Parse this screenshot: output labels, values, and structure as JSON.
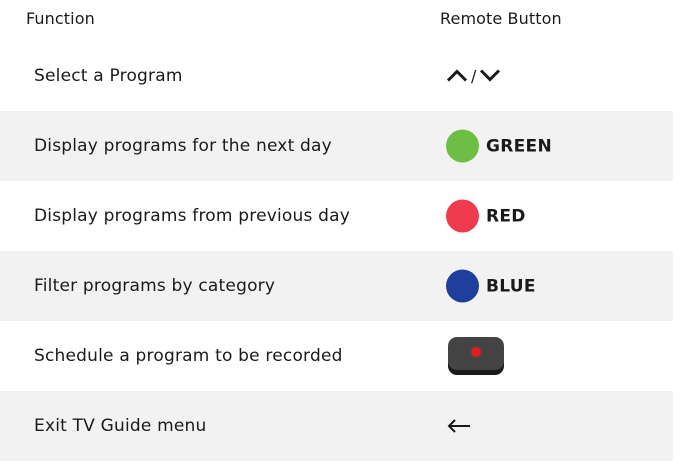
{
  "header": {
    "function_label": "Function",
    "button_label": "Remote Button"
  },
  "rows": [
    {
      "function": "Select a Program",
      "button": {
        "type": "arrows",
        "separator": "/",
        "icons": [
          "chevron-up-icon",
          "chevron-down-icon"
        ]
      }
    },
    {
      "function": "Display programs for the next day",
      "button": {
        "type": "color",
        "label": "GREEN",
        "color": "#6cbf44"
      }
    },
    {
      "function": "Display programs from previous day",
      "button": {
        "type": "color",
        "label": "RED",
        "color": "#ef3b4e"
      }
    },
    {
      "function": "Filter programs by category",
      "button": {
        "type": "color",
        "label": "BLUE",
        "color": "#1e3f9b"
      }
    },
    {
      "function": "Schedule a program to be recorded",
      "button": {
        "type": "record",
        "icon": "record-button-icon",
        "dot_color": "#e31b23"
      }
    },
    {
      "function": "Exit TV Guide menu",
      "button": {
        "type": "back",
        "icon": "back-arrow-icon"
      }
    }
  ],
  "colors": {
    "row_shade": "#f2f2f2",
    "text": "#1a1a1a"
  }
}
